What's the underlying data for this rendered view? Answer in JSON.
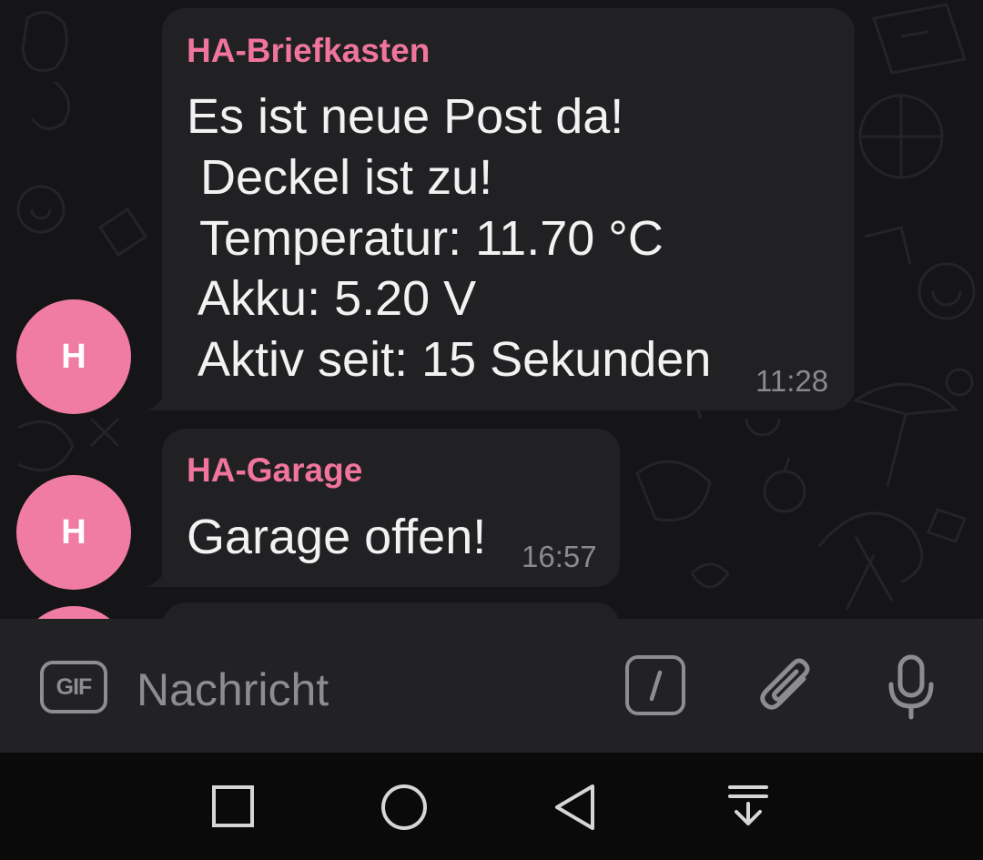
{
  "messages": [
    {
      "sender": "HA-Briefkasten",
      "avatar_letter": "H",
      "lines": [
        "Es ist neue Post da!",
        " Deckel ist zu!",
        " Temperatur: 11.70 °C",
        " Akku: 5.20 V",
        " Aktiv seit: 15 Sekunden"
      ],
      "time": "11:28"
    },
    {
      "sender": "HA-Garage",
      "avatar_letter": "H",
      "lines": [
        "Garage offen!"
      ],
      "time": "16:57"
    }
  ],
  "composer": {
    "gif_label": "GIF",
    "placeholder": "Nachricht",
    "command_icon": "slash-command-icon",
    "attach_icon": "paperclip-icon",
    "mic_icon": "microphone-icon"
  },
  "navbar": {
    "icons": [
      "square-recents-icon",
      "circle-home-icon",
      "triangle-back-icon",
      "notification-pulldown-icon"
    ]
  },
  "colors": {
    "accent": "#f0749c",
    "avatar": "#f17ca3",
    "bubble": "#212124",
    "chat_background": "#151517",
    "input_bar": "#222224",
    "nav_bar": "#0a0a0a"
  }
}
